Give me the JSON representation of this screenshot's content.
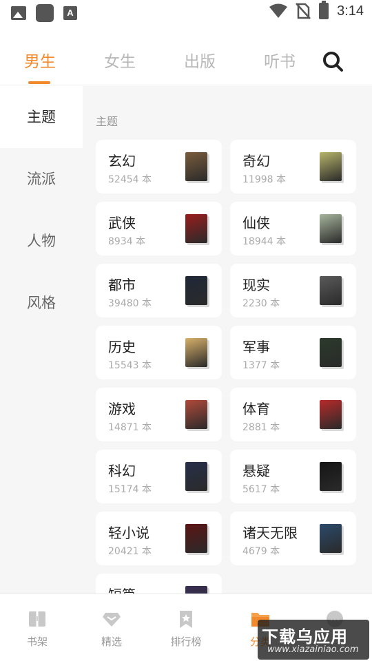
{
  "status_bar": {
    "time": "3:14",
    "left_icons": [
      "gallery-icon",
      "app-icon",
      "text-a-icon"
    ],
    "right_icons": [
      "wifi-icon",
      "no-sim-icon",
      "battery-charging-icon"
    ]
  },
  "top_tabs": {
    "items": [
      {
        "label": "男生",
        "active": true
      },
      {
        "label": "女生",
        "active": false
      },
      {
        "label": "出版",
        "active": false
      },
      {
        "label": "听书",
        "active": false
      }
    ],
    "search_icon": "search-icon",
    "accent_color": "#f08a2c"
  },
  "sidebar": {
    "items": [
      {
        "label": "主题",
        "active": true
      },
      {
        "label": "流派",
        "active": false
      },
      {
        "label": "人物",
        "active": false
      },
      {
        "label": "风格",
        "active": false
      }
    ]
  },
  "content": {
    "section_title": "主题",
    "categories": [
      {
        "name": "玄幻",
        "count": "52454 本",
        "cover_color": "#7a5c3c"
      },
      {
        "name": "奇幻",
        "count": "11998 本",
        "cover_color": "#b7b46a"
      },
      {
        "name": "武侠",
        "count": "8934 本",
        "cover_color": "#9a1d1d"
      },
      {
        "name": "仙侠",
        "count": "18944 本",
        "cover_color": "#a7b59c"
      },
      {
        "name": "都市",
        "count": "39480 本",
        "cover_color": "#1f2838"
      },
      {
        "name": "现实",
        "count": "2230 本",
        "cover_color": "#5a5a5a"
      },
      {
        "name": "历史",
        "count": "15543 本",
        "cover_color": "#d8b06a"
      },
      {
        "name": "军事",
        "count": "1377 本",
        "cover_color": "#2b3a2b"
      },
      {
        "name": "游戏",
        "count": "14871 本",
        "cover_color": "#b14a3a"
      },
      {
        "name": "体育",
        "count": "2881 本",
        "cover_color": "#b82a2a"
      },
      {
        "name": "科幻",
        "count": "15174 本",
        "cover_color": "#27304a"
      },
      {
        "name": "悬疑",
        "count": "5617 本",
        "cover_color": "#151515"
      },
      {
        "name": "轻小说",
        "count": "20421 本",
        "cover_color": "#5c1414"
      },
      {
        "name": "诸天无限",
        "count": "4679 本",
        "cover_color": "#2b4a6b"
      },
      {
        "name": "短篇",
        "count": "",
        "cover_color": "#3a2f55"
      }
    ]
  },
  "bottom_nav": {
    "items": [
      {
        "label": "书架",
        "icon": "book-icon",
        "active": false
      },
      {
        "label": "精选",
        "icon": "gem-icon",
        "active": false
      },
      {
        "label": "排行榜",
        "icon": "ranking-bookmark-icon",
        "active": false
      },
      {
        "label": "分类",
        "icon": "folder-icon",
        "active": true
      },
      {
        "label": "",
        "icon": "profile-icon",
        "active": false
      }
    ]
  },
  "watermark": {
    "main": "下载乌应用",
    "sub": "www.xiazainiao.com"
  }
}
